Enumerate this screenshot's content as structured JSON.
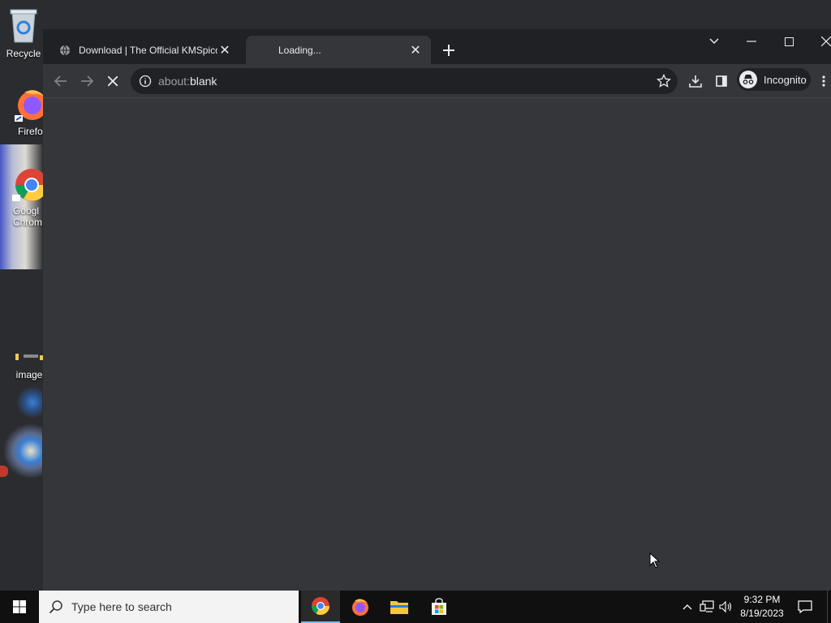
{
  "desktop": {
    "icons": [
      {
        "name": "recycle-bin",
        "label": "Recycle"
      },
      {
        "name": "firefox",
        "label": "Firefo:"
      },
      {
        "name": "google-chrome",
        "label": "Googl\nChrom"
      },
      {
        "name": "image",
        "label": "image"
      }
    ]
  },
  "browser": {
    "tabs": [
      {
        "title": "Download | The Official KMSpico"
      },
      {
        "title": "Loading..."
      }
    ],
    "address": {
      "scheme": "about:",
      "path": "blank"
    },
    "profile_label": "Incognito"
  },
  "taskbar": {
    "search_placeholder": "Type here to search",
    "time": "9:32 PM",
    "date": "8/19/2023"
  },
  "colors": {
    "window_bg": "#35363a",
    "tabstrip_bg": "#202124",
    "taskbar_bg": "#101010",
    "accent": "#76b9ed"
  }
}
